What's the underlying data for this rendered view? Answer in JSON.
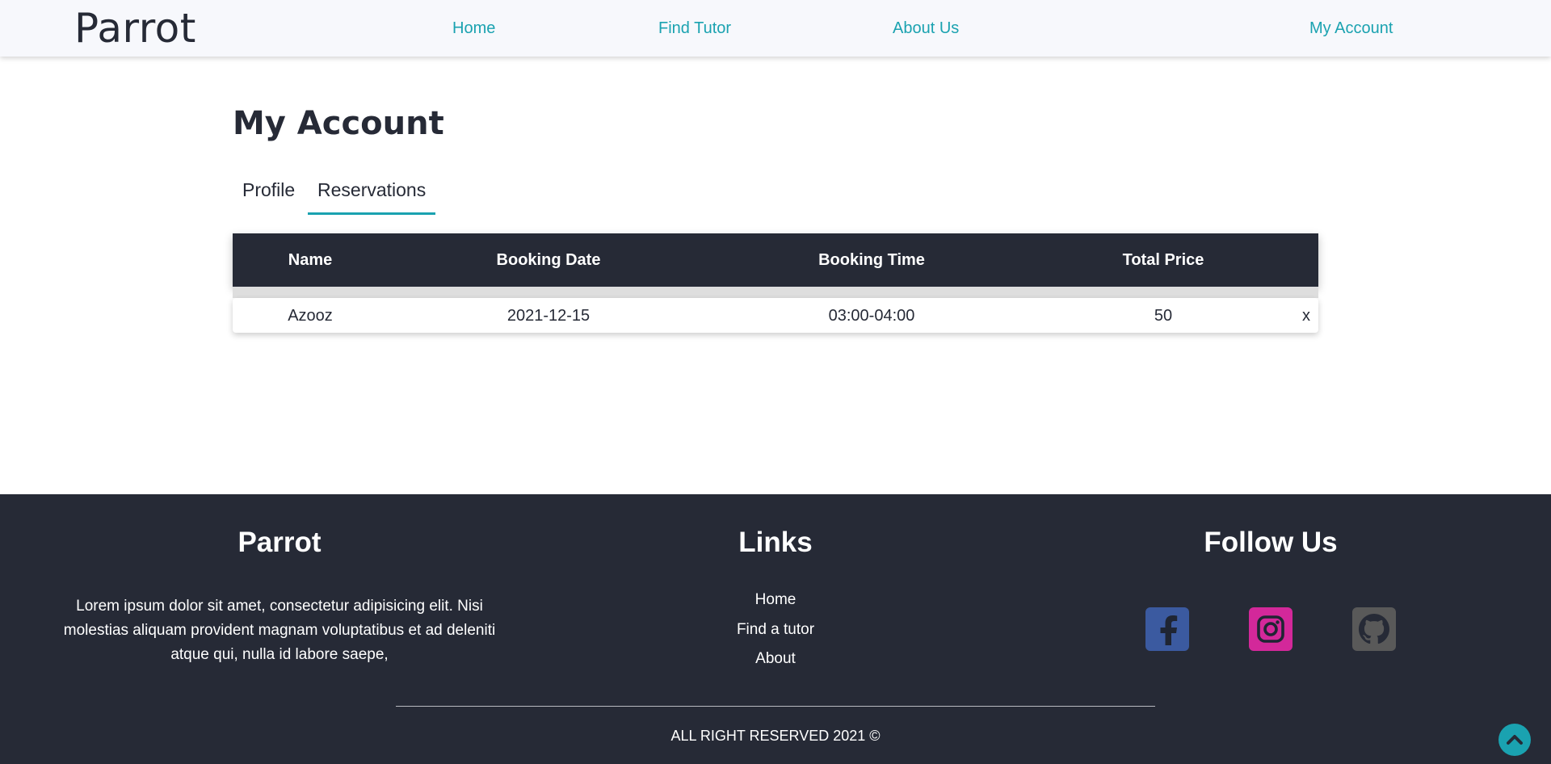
{
  "navbar": {
    "brand": "Parrot",
    "links": [
      "Home",
      "Find Tutor",
      "About Us"
    ],
    "account": "My Account"
  },
  "main": {
    "title": "My Account",
    "tabs": [
      "Profile",
      "Reservations"
    ],
    "active_tab": "Reservations",
    "table": {
      "headers": [
        "Name",
        "Booking Date",
        "Booking Time",
        "Total Price"
      ],
      "rows": [
        {
          "name": "Azooz",
          "date": "2021-12-15",
          "time": "03:00-04:00",
          "price": "50",
          "remove": "x"
        }
      ]
    }
  },
  "footer": {
    "brand_title": "Parrot",
    "description": "Lorem ipsum dolor sit amet, consectetur adipisicing elit. Nisi molestias aliquam provident magnam voluptatibus et ad deleniti atque qui, nulla id labore saepe,",
    "links_title": "Links",
    "links": [
      "Home",
      "Find a tutor",
      "About"
    ],
    "follow_title": "Follow Us",
    "socials": [
      {
        "icon": "facebook-icon",
        "color": "#3b5aa0"
      },
      {
        "icon": "instagram-icon",
        "color": "#d3289a"
      },
      {
        "icon": "github-icon",
        "color": "#595959"
      }
    ],
    "copyright": "ALL RIGHT RESERVED 2021 ©"
  },
  "colors": {
    "accent": "#1aa2b0",
    "dark": "#262a36",
    "navbar_bg": "#f7f8fc"
  }
}
